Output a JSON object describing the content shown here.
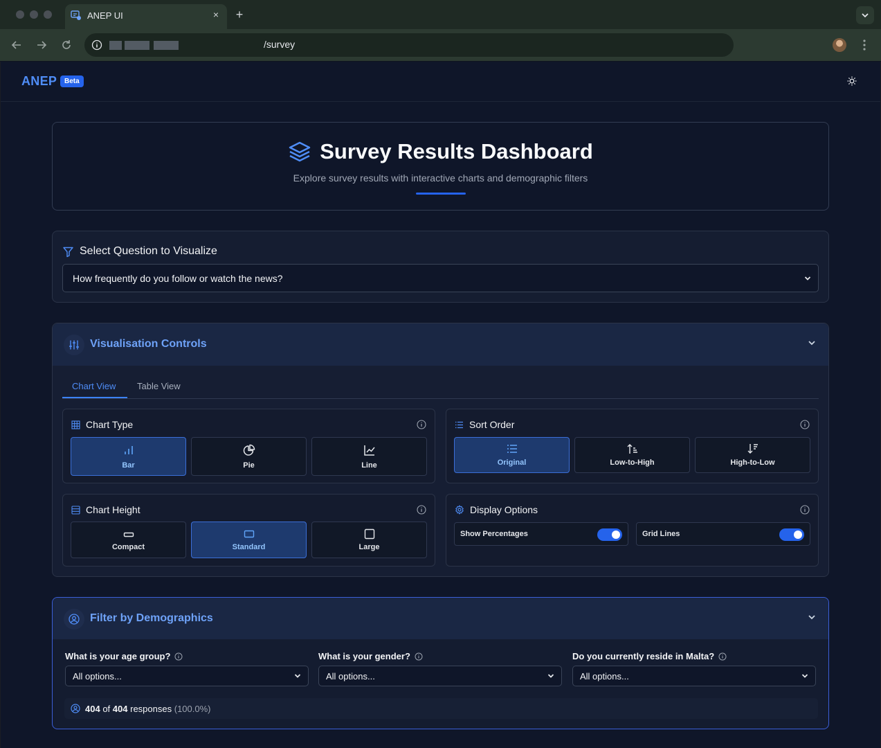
{
  "browser": {
    "tab_title": "ANEP UI",
    "tab_close_glyph": "×",
    "new_tab_glyph": "+",
    "url_path": "/survey"
  },
  "app": {
    "logo": "ANEP",
    "badge": "Beta",
    "accent_color": "#2563eb"
  },
  "hero": {
    "title": "Survey Results Dashboard",
    "subtitle": "Explore survey results with interactive charts and demographic filters"
  },
  "question": {
    "label": "Select Question to Visualize",
    "selected": "How frequently do you follow or watch the news?"
  },
  "viz": {
    "title": "Visualisation Controls",
    "tabs": [
      {
        "label": "Chart View",
        "active": true
      },
      {
        "label": "Table View",
        "active": false
      }
    ],
    "chart_type": {
      "title": "Chart Type",
      "options": [
        {
          "label": "Bar",
          "icon": "bar-chart-icon",
          "active": true
        },
        {
          "label": "Pie",
          "icon": "pie-chart-icon",
          "active": false
        },
        {
          "label": "Line",
          "icon": "line-chart-icon",
          "active": false
        }
      ]
    },
    "sort_order": {
      "title": "Sort Order",
      "options": [
        {
          "label": "Original",
          "icon": "list-icon",
          "active": true
        },
        {
          "label": "Low-to-High",
          "icon": "sort-ascending-icon",
          "active": false
        },
        {
          "label": "High-to-Low",
          "icon": "sort-descending-icon",
          "active": false
        }
      ]
    },
    "chart_height": {
      "title": "Chart Height",
      "options": [
        {
          "label": "Compact",
          "icon": "compact-rect-icon",
          "active": false
        },
        {
          "label": "Standard",
          "icon": "standard-rect-icon",
          "active": true
        },
        {
          "label": "Large",
          "icon": "large-square-icon",
          "active": false
        }
      ]
    },
    "display_options": {
      "title": "Display Options",
      "toggles": [
        {
          "label": "Show Percentages",
          "on": true
        },
        {
          "label": "Grid Lines",
          "on": true
        }
      ]
    }
  },
  "filters": {
    "title": "Filter by Demographics",
    "fields": [
      {
        "label": "What is your age group?",
        "value": "All options..."
      },
      {
        "label": "What is your gender?",
        "value": "All options..."
      },
      {
        "label": "Do you currently reside in Malta?",
        "value": "All options..."
      }
    ],
    "responses": {
      "shown": "404",
      "of": "of",
      "total": "404",
      "suffix": "responses",
      "percent": "(100.0%)"
    }
  }
}
